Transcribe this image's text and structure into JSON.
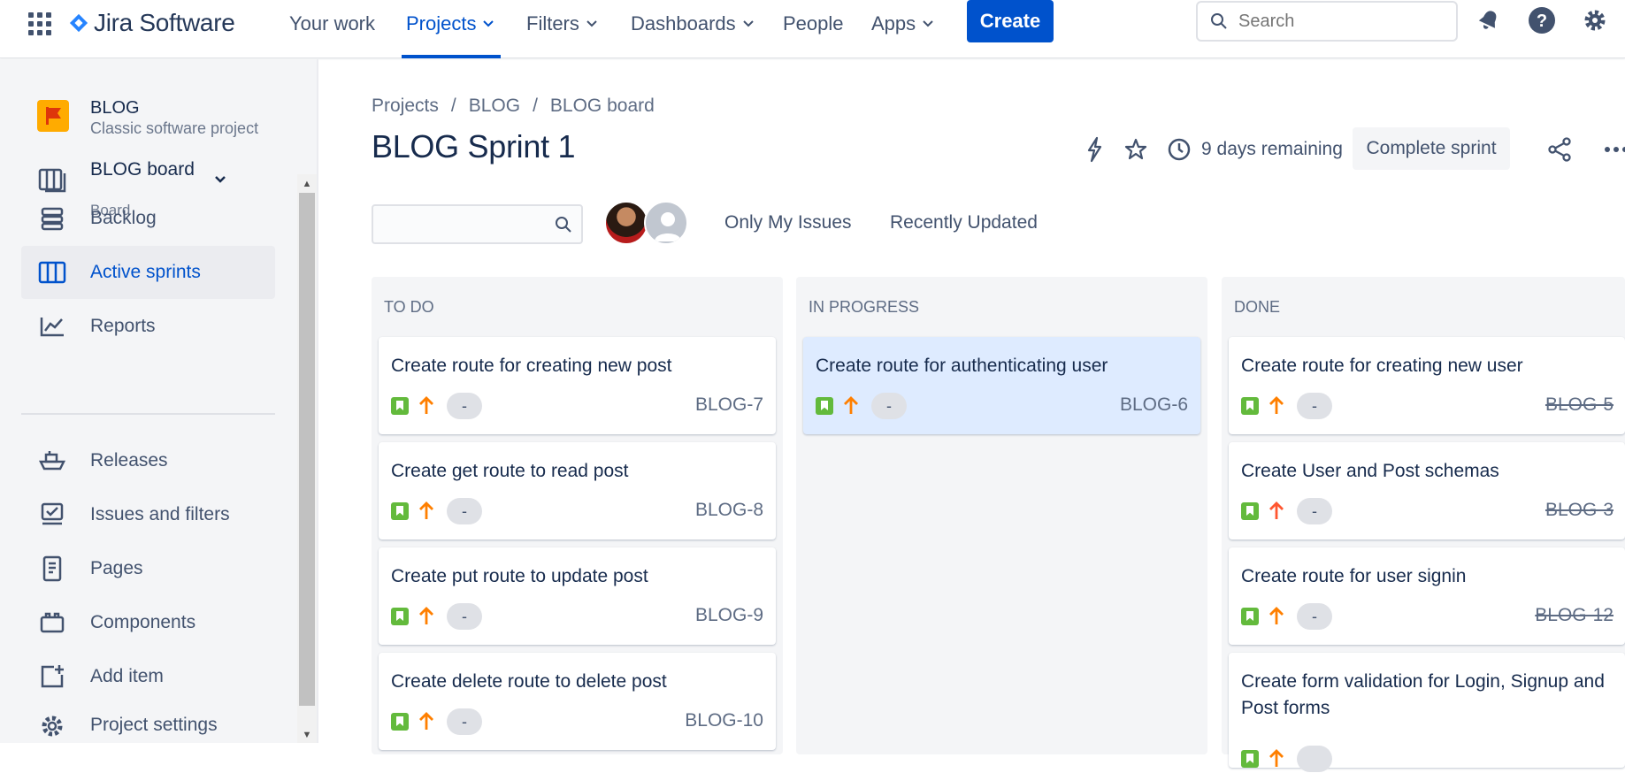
{
  "topnav": {
    "product": "Jira Software",
    "items": [
      {
        "label": "Your work"
      },
      {
        "label": "Projects"
      },
      {
        "label": "Filters"
      },
      {
        "label": "Dashboards"
      },
      {
        "label": "People"
      },
      {
        "label": "Apps"
      }
    ],
    "create_label": "Create",
    "search_placeholder": "Search"
  },
  "sidebar": {
    "project_name": "BLOG",
    "project_type": "Classic software project",
    "board_label": "BLOG board",
    "board_sub": "Board",
    "items": [
      {
        "label": "Backlog",
        "icon": "backlog-icon"
      },
      {
        "label": "Active sprints",
        "icon": "board-columns-icon"
      },
      {
        "label": "Reports",
        "icon": "chart-line-icon"
      },
      {
        "label": "Releases",
        "icon": "ship-icon"
      },
      {
        "label": "Issues and filters",
        "icon": "issues-icon"
      },
      {
        "label": "Pages",
        "icon": "page-icon"
      },
      {
        "label": "Components",
        "icon": "component-icon"
      },
      {
        "label": "Add item",
        "icon": "add-item-icon"
      },
      {
        "label": "Project settings",
        "icon": "gear-icon"
      }
    ]
  },
  "breadcrumb": [
    "Projects",
    "BLOG",
    "BLOG board"
  ],
  "breadcrumb_sep": "/",
  "title": "BLOG Sprint 1",
  "days_remaining": "9 days remaining",
  "complete_sprint": "Complete sprint",
  "filters": {
    "only_my_issues": "Only My Issues",
    "recently_updated": "Recently Updated"
  },
  "columns": [
    {
      "title": "TO DO",
      "cards": [
        {
          "title": "Create route for creating new post",
          "estimate": "-",
          "key": "BLOG-7",
          "priority": "medium"
        },
        {
          "title": "Create get route to read post",
          "estimate": "-",
          "key": "BLOG-8",
          "priority": "medium"
        },
        {
          "title": "Create put route to update post",
          "estimate": "-",
          "key": "BLOG-9",
          "priority": "medium"
        },
        {
          "title": "Create delete route to delete post",
          "estimate": "-",
          "key": "BLOG-10",
          "priority": "medium"
        }
      ]
    },
    {
      "title": "IN PROGRESS",
      "cards": [
        {
          "title": "Create route for authenticating user",
          "estimate": "-",
          "key": "BLOG-6",
          "priority": "medium"
        }
      ]
    },
    {
      "title": "DONE",
      "cards": [
        {
          "title": "Create route for creating new user",
          "estimate": "-",
          "key": "BLOG-5",
          "priority": "medium"
        },
        {
          "title": "Create User and Post schemas",
          "estimate": "-",
          "key": "BLOG-3",
          "priority": "high"
        },
        {
          "title": "Create route for user signin",
          "estimate": "-",
          "key": "BLOG-12",
          "priority": "medium"
        },
        {
          "title": "Create form validation for Login, Signup and Post forms",
          "estimate": "",
          "key": "",
          "priority": "medium"
        }
      ]
    }
  ],
  "colors": {
    "brand_blue": "#0052cc",
    "story_green": "#63ba3c",
    "priority_medium": "#ff7f00",
    "priority_high": "#ff5630",
    "highlight_card": "#deebff"
  }
}
